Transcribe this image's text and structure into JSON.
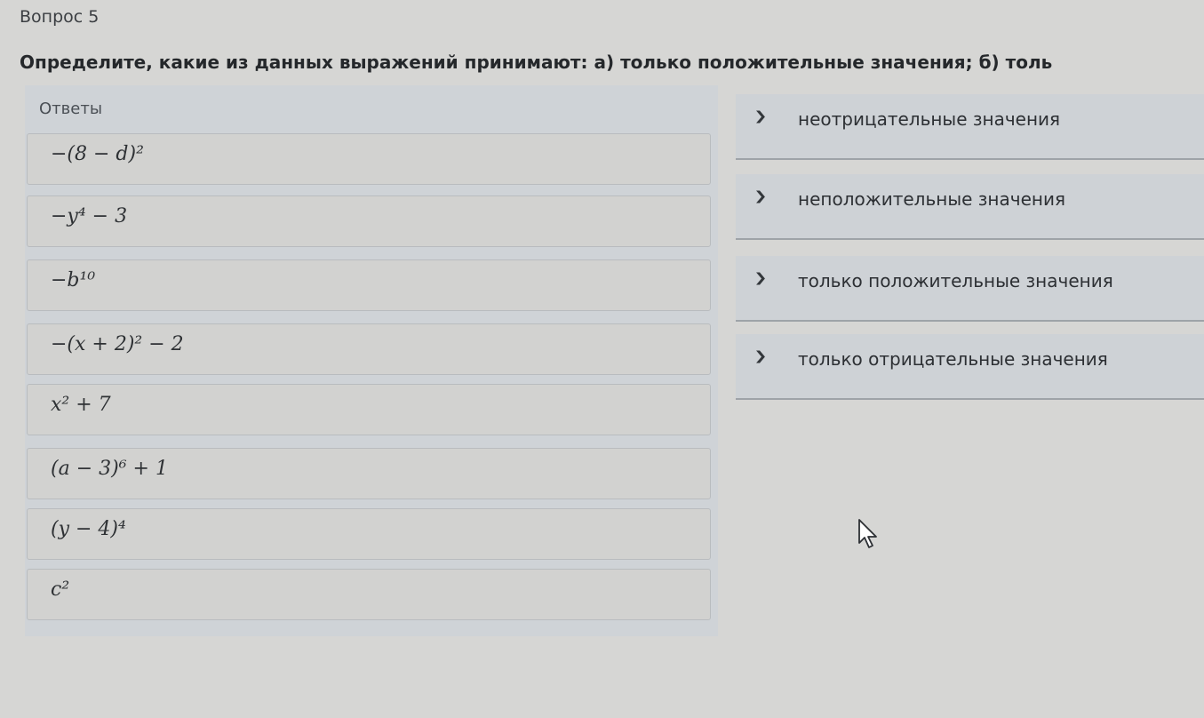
{
  "question": {
    "number": "Вопрос 5",
    "text": "Определите, какие из данных выражений принимают: а) только положительные значения; б) толь"
  },
  "answers": {
    "label": "Ответы",
    "items": [
      "−(8 − d)²",
      "−y⁴ − 3",
      "−b¹⁰",
      "−(x + 2)² − 2",
      "x² + 7",
      "(a − 3)⁶ + 1",
      "(y − 4)⁴",
      "c²"
    ]
  },
  "targets": [
    {
      "label": "неотрицательные значения",
      "icon": "chevron-down-icon"
    },
    {
      "label": "неположительные значения",
      "icon": "chevron-down-icon"
    },
    {
      "label": "только положительные значения",
      "icon": "chevron-down-icon"
    },
    {
      "label": "только отрицательные значения",
      "icon": "chevron-down-icon"
    }
  ],
  "colors": {
    "background": "#d6d6d4",
    "panel": "#cfd3d7",
    "card": "#d2d2d0"
  }
}
